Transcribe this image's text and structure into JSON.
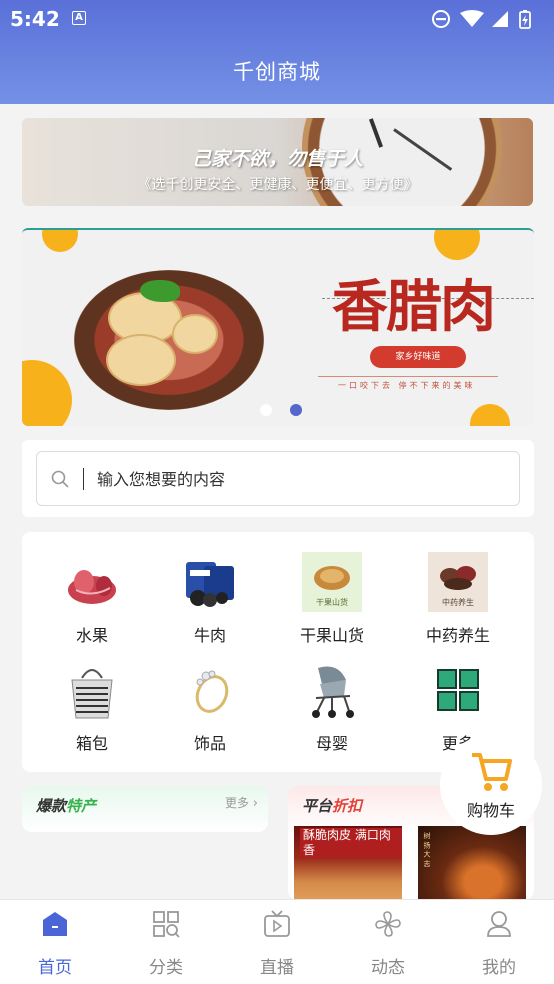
{
  "status_bar": {
    "time": "5:42",
    "a_badge": "A"
  },
  "header": {
    "title": "千创商城"
  },
  "banner_top": {
    "slogan": "己家不欲，勿售于人",
    "subtitle": "《选千创更安全、更健康、更便宜、更方便》"
  },
  "carousel": {
    "title": "香腊肉",
    "pill_text": "家乡好味道",
    "tagline": "一口咬下去 停不下来的美味",
    "active_dot": 1,
    "dot_colors": [
      "#ffffff",
      "#5566cc"
    ]
  },
  "search": {
    "placeholder": "输入您想要的内容"
  },
  "categories": [
    {
      "label": "水果",
      "icon": "fruit-icon"
    },
    {
      "label": "牛肉",
      "icon": "beef-icon"
    },
    {
      "label": "干果山货",
      "icon": "dried-fruit-icon",
      "image_text": "干果山货"
    },
    {
      "label": "中药养生",
      "icon": "herbal-icon",
      "image_text": "中药养生"
    },
    {
      "label": "箱包",
      "icon": "bag-icon"
    },
    {
      "label": "饰品",
      "icon": "jewelry-icon"
    },
    {
      "label": "母婴",
      "icon": "baby-stroller-icon"
    },
    {
      "label": "更多",
      "icon": "more-grid-icon"
    }
  ],
  "cart": {
    "label": "购物车"
  },
  "promos": {
    "hot": {
      "title_a": "爆款",
      "title_b": "特产",
      "more": "更多"
    },
    "discount": {
      "title_a": "平台",
      "title_b": "折扣",
      "product1_text": "酥脆肉皮 满口肉香",
      "product2_text": "树 扬 大 志"
    }
  },
  "nav": [
    {
      "label": "首页",
      "icon": "home-icon",
      "active": true
    },
    {
      "label": "分类",
      "icon": "category-icon",
      "active": false
    },
    {
      "label": "直播",
      "icon": "live-tv-icon",
      "active": false
    },
    {
      "label": "动态",
      "icon": "pinwheel-icon",
      "active": false
    },
    {
      "label": "我的",
      "icon": "user-icon",
      "active": false
    }
  ],
  "colors": {
    "header_start": "#5a70d8",
    "header_end": "#7491e6",
    "accent": "#4a66d6",
    "cart_orange": "#f5a623",
    "hot_green": "#38b24f",
    "discount_red": "#e2423a"
  }
}
